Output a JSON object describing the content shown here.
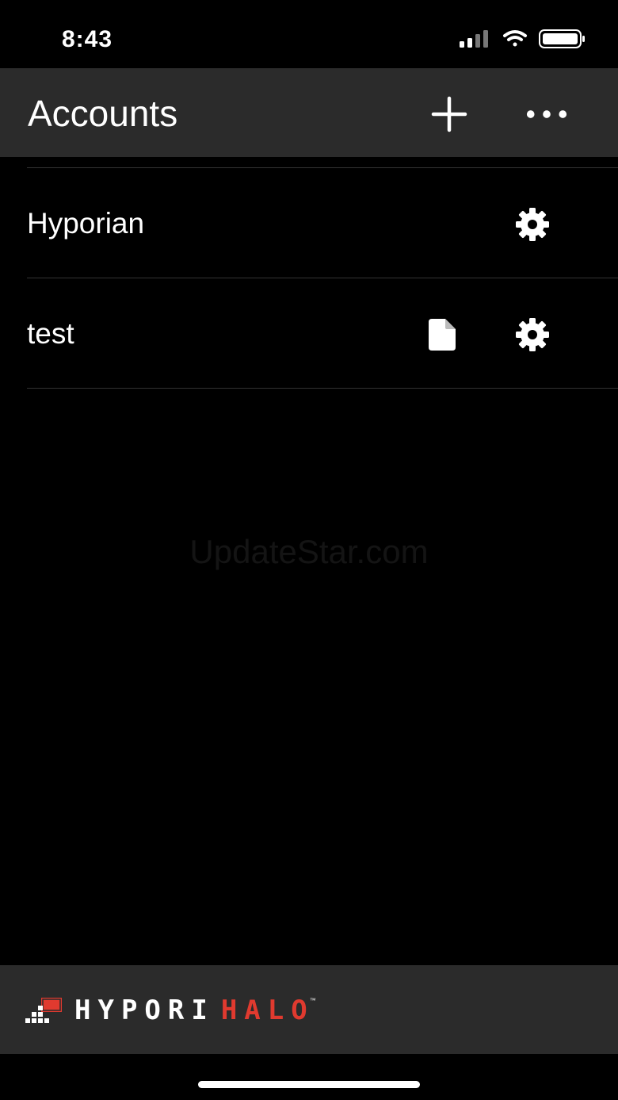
{
  "status_bar": {
    "time": "8:43"
  },
  "header": {
    "title": "Accounts",
    "add_icon": "plus-icon",
    "more_icon": "ellipsis-icon"
  },
  "accounts": [
    {
      "name": "Hyporian",
      "has_document": false
    },
    {
      "name": "test",
      "has_document": true
    }
  ],
  "watermark": "UpdateStar.com",
  "footer": {
    "brand_primary": "HYPORI",
    "brand_secondary": "HALO",
    "brand_tm": "™",
    "brand_color": "#e03a2f"
  }
}
